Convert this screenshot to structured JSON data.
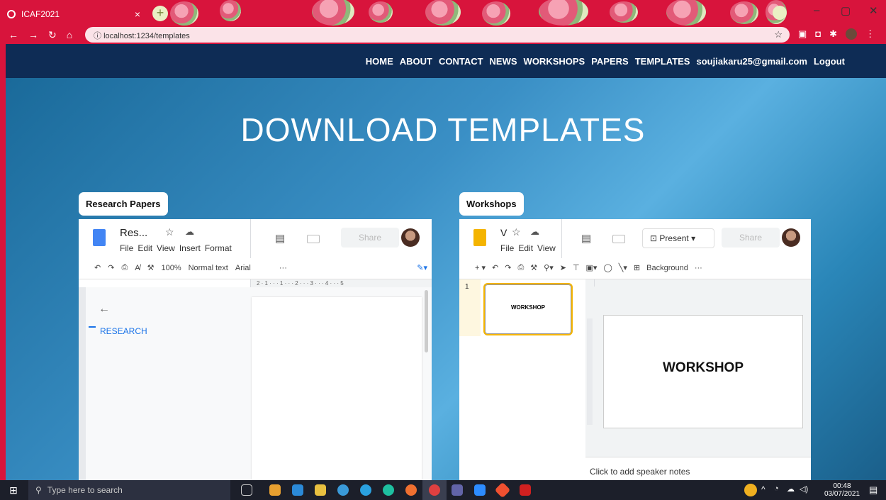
{
  "browser": {
    "tab_title": "ICAF2021",
    "tab_close": "×",
    "new_tab": "+",
    "url": "localhost:1234/templates",
    "win_minimize": "–",
    "win_maximize": "▢",
    "win_close": "✕"
  },
  "nav": {
    "items": [
      "HOME",
      "ABOUT",
      "CONTACT",
      "NEWS",
      "WORKSHOPS",
      "PAPERS",
      "TEMPLATES",
      "soujiakaru25@gmail.com",
      "Logout"
    ]
  },
  "page": {
    "heading": "DOWNLOAD TEMPLATES"
  },
  "research": {
    "label": "Research Papers",
    "doc_title": "Res...",
    "menus": [
      "File",
      "Edit",
      "View",
      "Insert",
      "Format"
    ],
    "share": "Share",
    "zoom": "100%",
    "style": "Normal text",
    "font": "Arial",
    "more": "···",
    "outline_back": "←",
    "outline_item": "RESEARCH",
    "ruler": "2 · 1 · · · 1 · · · 2 · · · 3 · · · 4 · · · 5"
  },
  "workshops": {
    "label": "Workshops",
    "doc_title": "V",
    "menus": [
      "File",
      "Edit",
      "View"
    ],
    "present": "Present",
    "share": "Share",
    "background": "Background",
    "more": "···",
    "slide_num": "1",
    "thumb_text": "WORKSHOP",
    "slide_text": "WORKSHOP",
    "speaker_notes": "Click to add speaker notes"
  },
  "taskbar": {
    "search_placeholder": "Type here to search",
    "time": "00:48",
    "date": "03/07/2021"
  },
  "colors": {
    "brand_red": "#d8143c",
    "nav_navy": "#0e2c55",
    "docs_blue": "#4285f4",
    "slides_yellow": "#f4b400"
  }
}
